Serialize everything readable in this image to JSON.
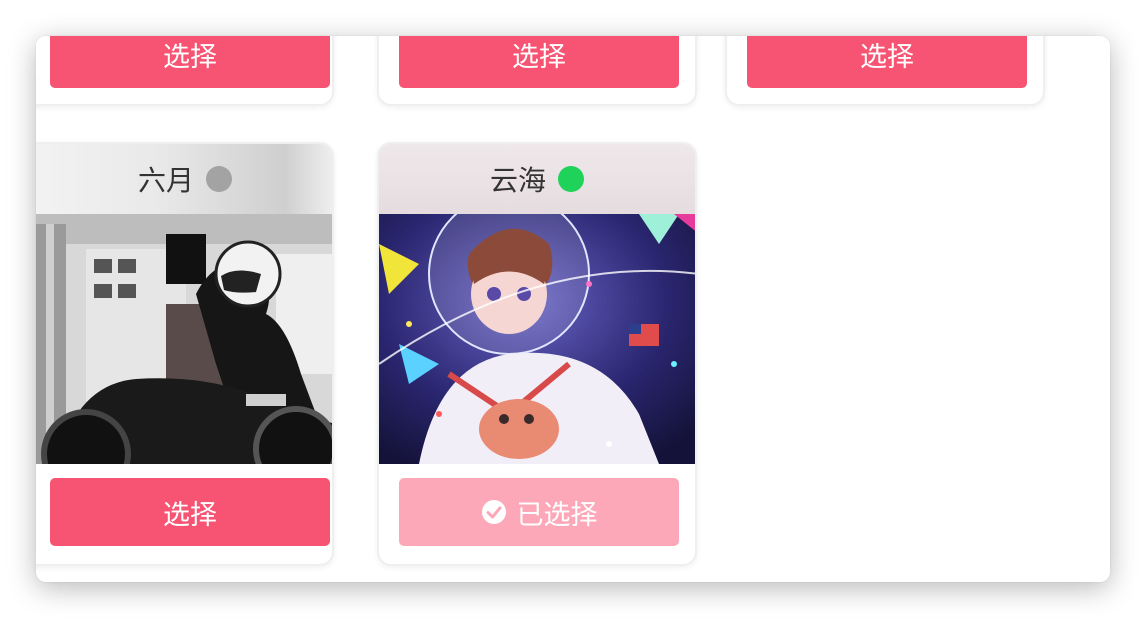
{
  "cards_top": [
    {
      "select_label": "选择"
    },
    {
      "select_label": "选择"
    },
    {
      "select_label": "选择"
    }
  ],
  "cards_bottom": [
    {
      "name": "六月",
      "status": "offline",
      "status_color": "#a3a3a3",
      "image_alt": "motorcycle-rider-photo",
      "select_label": "选择",
      "selected": false
    },
    {
      "name": "云海",
      "status": "online",
      "status_color": "#1fd35a",
      "image_alt": "astronaut-girl-illustration",
      "select_label": "已选择",
      "selected": true
    }
  ],
  "colors": {
    "primary": "#f75373",
    "selected": "#fca8b8"
  }
}
